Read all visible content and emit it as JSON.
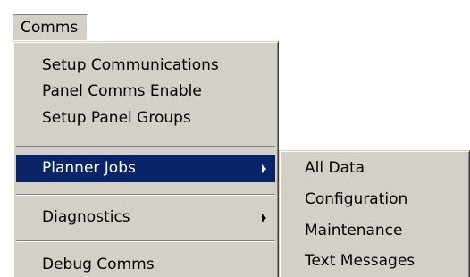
{
  "menubar": {
    "comms_label": "Comms"
  },
  "main_menu": {
    "items": [
      {
        "label": "Setup Communications"
      },
      {
        "label": "Panel Comms Enable"
      },
      {
        "label": "Setup Panel Groups"
      },
      {
        "label": "Planner Jobs",
        "has_submenu": true,
        "selected": true
      },
      {
        "label": "Diagnostics",
        "has_submenu": true
      },
      {
        "label": "Debug Comms"
      }
    ]
  },
  "sub_menu": {
    "items": [
      {
        "label": "All Data"
      },
      {
        "label": "Configuration"
      },
      {
        "label": "Maintenance"
      },
      {
        "label": "Text Messages"
      }
    ]
  },
  "colors": {
    "menu_face": "#d4d0c8",
    "selection": "#0a246a",
    "selection_text": "#ffffff"
  },
  "icons": {
    "submenu_arrow": "triangle-right-icon"
  }
}
